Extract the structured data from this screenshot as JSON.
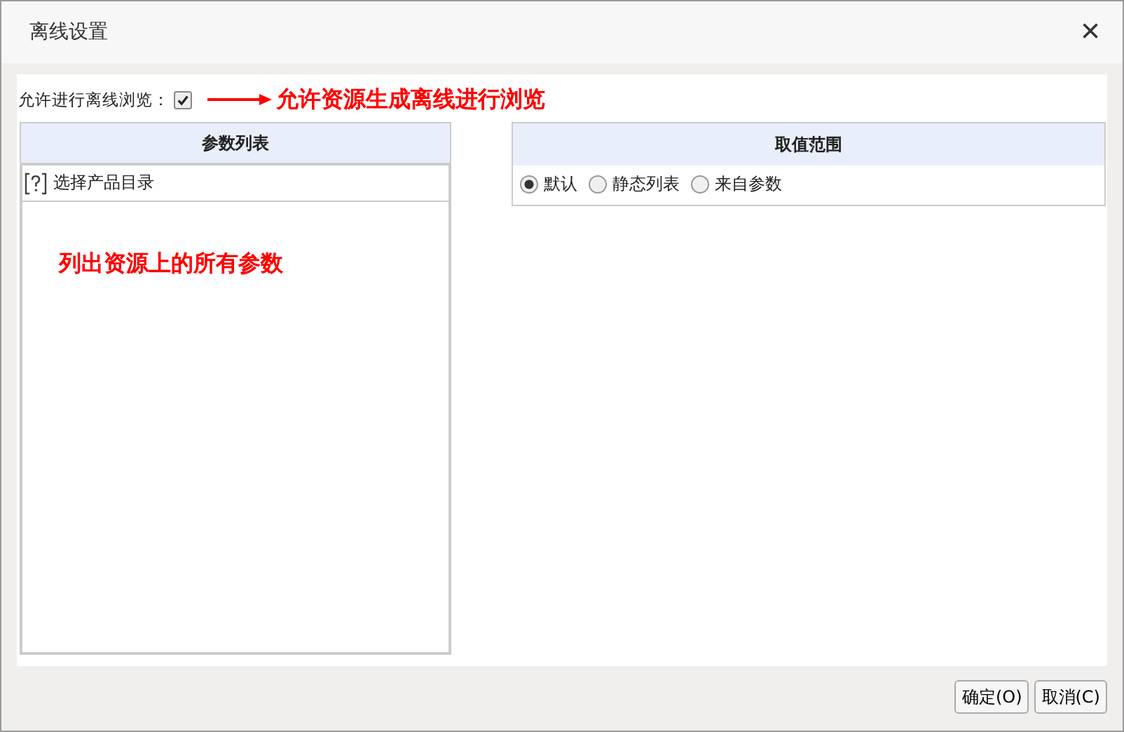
{
  "window": {
    "title": "离线设置",
    "close": "×"
  },
  "offline": {
    "label": "允许进行离线浏览：",
    "checked": true,
    "annotation": "允许资源生成离线进行浏览"
  },
  "param_list": {
    "header": "参数列表",
    "items": [
      {
        "label": "选择产品目录",
        "selected": false
      }
    ],
    "annotation": "列出资源上的所有参数"
  },
  "value_range": {
    "header": "取值范围",
    "options": [
      {
        "label": "默认",
        "selected": true
      },
      {
        "label": "静态列表",
        "selected": false
      },
      {
        "label": "来自参数",
        "selected": false
      }
    ]
  },
  "buttons": [
    "确定(O)",
    "取消(C)"
  ]
}
